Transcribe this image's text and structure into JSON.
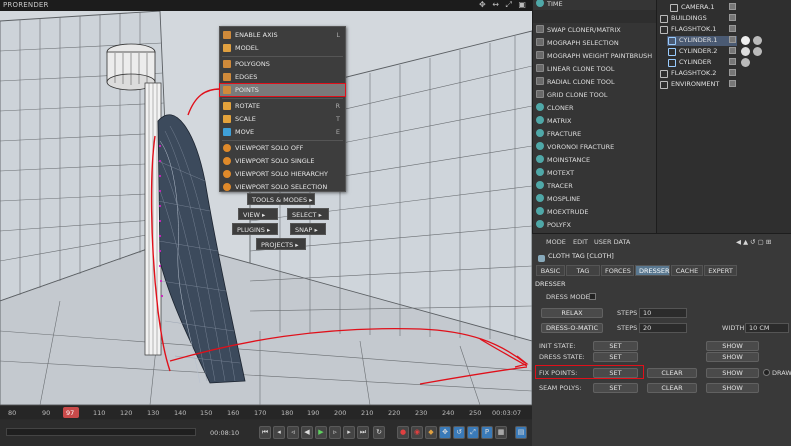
{
  "viewport": {
    "title": "PRORENDER",
    "nav_icons": "✥ ↔ ⤢ ▣"
  },
  "context_menu": {
    "items": [
      {
        "label": "ENABLE AXIS",
        "shortcut": "L",
        "icon": "axis-icon",
        "color": "#d08a3a"
      },
      {
        "label": "MODEL",
        "shortcut": "",
        "icon": "model-icon",
        "color": "#e0a040"
      },
      {
        "label": "POLYGONS",
        "shortcut": "",
        "icon": "polygons-icon",
        "color": "#d08a3a"
      },
      {
        "label": "EDGES",
        "shortcut": "",
        "icon": "edges-icon",
        "color": "#d08a3a"
      },
      {
        "label": "POINTS",
        "shortcut": "",
        "icon": "points-icon",
        "color": "#d08a3a"
      },
      {
        "label": "ROTATE",
        "shortcut": "R",
        "icon": "rotate-icon",
        "color": "#e3a23b"
      },
      {
        "label": "SCALE",
        "shortcut": "T",
        "icon": "scale-icon",
        "color": "#e3a23b"
      },
      {
        "label": "MOVE",
        "shortcut": "E",
        "icon": "move-icon",
        "color": "#3fa0d8"
      },
      {
        "label": "VIEWPORT SOLO OFF",
        "shortcut": "",
        "icon": "solo-off-icon",
        "color": "#e08a2a"
      },
      {
        "label": "VIEWPORT SOLO SINGLE",
        "shortcut": "",
        "icon": "solo-single-icon",
        "color": "#e08a2a"
      },
      {
        "label": "VIEWPORT SOLO HIERARCHY",
        "shortcut": "",
        "icon": "solo-hierarchy-icon",
        "color": "#e08a2a"
      },
      {
        "label": "VIEWPORT SOLO SELECTION",
        "shortcut": "",
        "icon": "solo-selection-icon",
        "color": "#e08a2a"
      }
    ],
    "submenus": {
      "tools_modes": "TOOLS & MODES",
      "view": "VIEW",
      "select": "SELECT",
      "plugins": "PLUGINS",
      "snap": "SNAP",
      "projects": "PROJECTS"
    }
  },
  "timeline": {
    "ticks": [
      "80",
      "90",
      "100",
      "110",
      "120",
      "130",
      "140",
      "150",
      "160",
      "170",
      "180",
      "190",
      "200",
      "210",
      "220",
      "230",
      "240",
      "250"
    ],
    "current_frame": "97",
    "timecode": "00:03:07",
    "start_time": "00:08:10"
  },
  "mograph_tools": {
    "items": [
      {
        "label": "TIME"
      },
      {
        "label": ""
      },
      {
        "label": "SWAP CLONER/MATRIX"
      },
      {
        "label": "MOGRAPH SELECTION"
      },
      {
        "label": "MOGRAPH WEIGHT PAINTBRUSH"
      },
      {
        "label": "LINEAR CLONE TOOL"
      },
      {
        "label": "RADIAL CLONE TOOL"
      },
      {
        "label": "GRID CLONE TOOL"
      },
      {
        "label": "CLONER"
      },
      {
        "label": "MATRIX"
      },
      {
        "label": "FRACTURE"
      },
      {
        "label": "VORONOI FRACTURE"
      },
      {
        "label": "MOINSTANCE"
      },
      {
        "label": "MOTEXT"
      },
      {
        "label": "TRACER"
      },
      {
        "label": "MOSPLINE"
      },
      {
        "label": "MOEXTRUDE"
      },
      {
        "label": "POLYFX"
      }
    ]
  },
  "objects": {
    "items": [
      {
        "label": "CAMERA.1",
        "indent": 1
      },
      {
        "label": "BUILDINGS",
        "indent": 0
      },
      {
        "label": "FLAGSHTOK.1",
        "indent": 0
      },
      {
        "label": "CYLINDER.1",
        "indent": 1
      },
      {
        "label": "CYLINDER.2",
        "indent": 1
      },
      {
        "label": "CYLINDER",
        "indent": 1
      },
      {
        "label": "FLAGSHTOK.2",
        "indent": 0
      },
      {
        "label": "ENVIRONMENT",
        "indent": 0
      }
    ]
  },
  "attributes": {
    "menu": [
      "MODE",
      "EDIT",
      "USER DATA"
    ],
    "tag_title": "CLOTH TAG [CLOTH]",
    "tabs": [
      "BASIC",
      "TAG",
      "FORCES",
      "DRESSER",
      "CACHE",
      "EXPERT"
    ],
    "active_tab": "DRESSER",
    "section": "DRESSER",
    "dress_mode_label": "DRESS MODE",
    "relax_label": "RELAX",
    "steps_label": "STEPS",
    "steps_relax_value": "10",
    "dress_o_matic_label": "DRESS-O-MATIC",
    "steps_dress_value": "20",
    "width_label": "WIDTH",
    "width_value": "10 CM",
    "init_state_label": "INIT STATE:",
    "dress_state_label": "DRESS STATE:",
    "fix_points_label": "FIX POINTS:",
    "seam_polys_label": "SEAM POLYS:",
    "set_label": "SET",
    "show_label": "SHOW",
    "clear_label": "CLEAR",
    "draw_label": "DRAW"
  },
  "colors": {
    "annotation_red": "#e0101a",
    "highlight_gray": "#7a7a7a",
    "tab_active": "#5a7890"
  }
}
